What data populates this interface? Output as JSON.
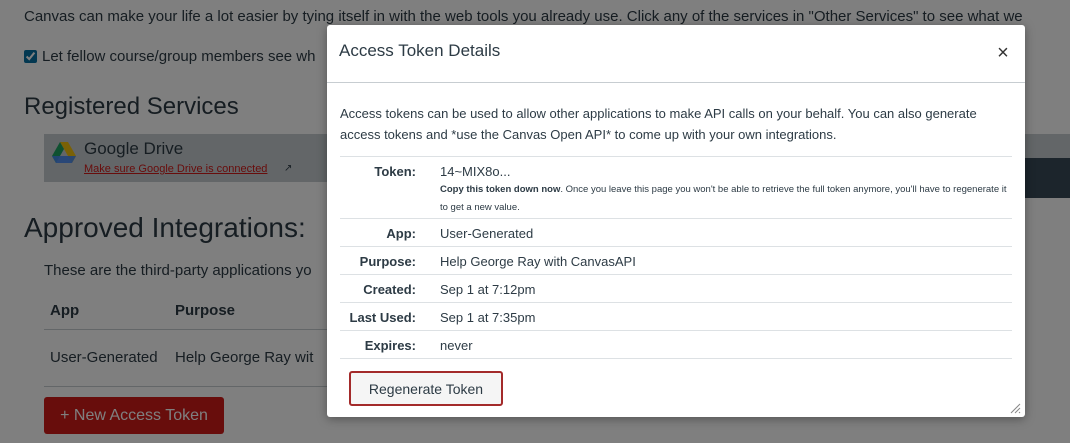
{
  "background": {
    "intro_text": "Canvas can make your life a lot easier by tying itself in with the web tools you already use. Click any of the services in \"Other Services\" to see what we",
    "share_label": "Let fellow course/group members see wh",
    "registered_heading": "Registered Services",
    "google_drive": {
      "name": "Google Drive",
      "link": "Make sure Google Drive is connected"
    },
    "approved_heading": "Approved Integrations:",
    "approved_desc": "These are the third-party applications yo",
    "columns": {
      "app": "App",
      "purpose": "Purpose"
    },
    "row": {
      "app": "User-Generated",
      "purpose": "Help George Ray wit"
    },
    "new_token_button": "+ New Access Token"
  },
  "modal": {
    "title": "Access Token Details",
    "close_glyph": "×",
    "description": "Access tokens can be used to allow other applications to make API calls on your behalf. You can also generate access tokens and *use the Canvas Open API* to come up with your own integrations.",
    "token": {
      "label": "Token:",
      "value": "14~MIX8o...",
      "warning_bold": "Copy this token down now",
      "warning_rest": ". Once you leave this page you won't be able to retrieve the full token anymore, you'll have to regenerate it to get a new value."
    },
    "fields": [
      {
        "label": "App:",
        "value": "User-Generated"
      },
      {
        "label": "Purpose:",
        "value": "Help George Ray with CanvasAPI"
      },
      {
        "label": "Created:",
        "value": "Sep 1 at 7:12pm"
      },
      {
        "label": "Last Used:",
        "value": "Sep 1 at 7:35pm"
      },
      {
        "label": "Expires:",
        "value": "never"
      }
    ],
    "regenerate_button": "Regenerate Token"
  },
  "colors": {
    "brand_red": "#d01a19",
    "text": "#2d3b45",
    "regen_border": "#a32a2a"
  }
}
